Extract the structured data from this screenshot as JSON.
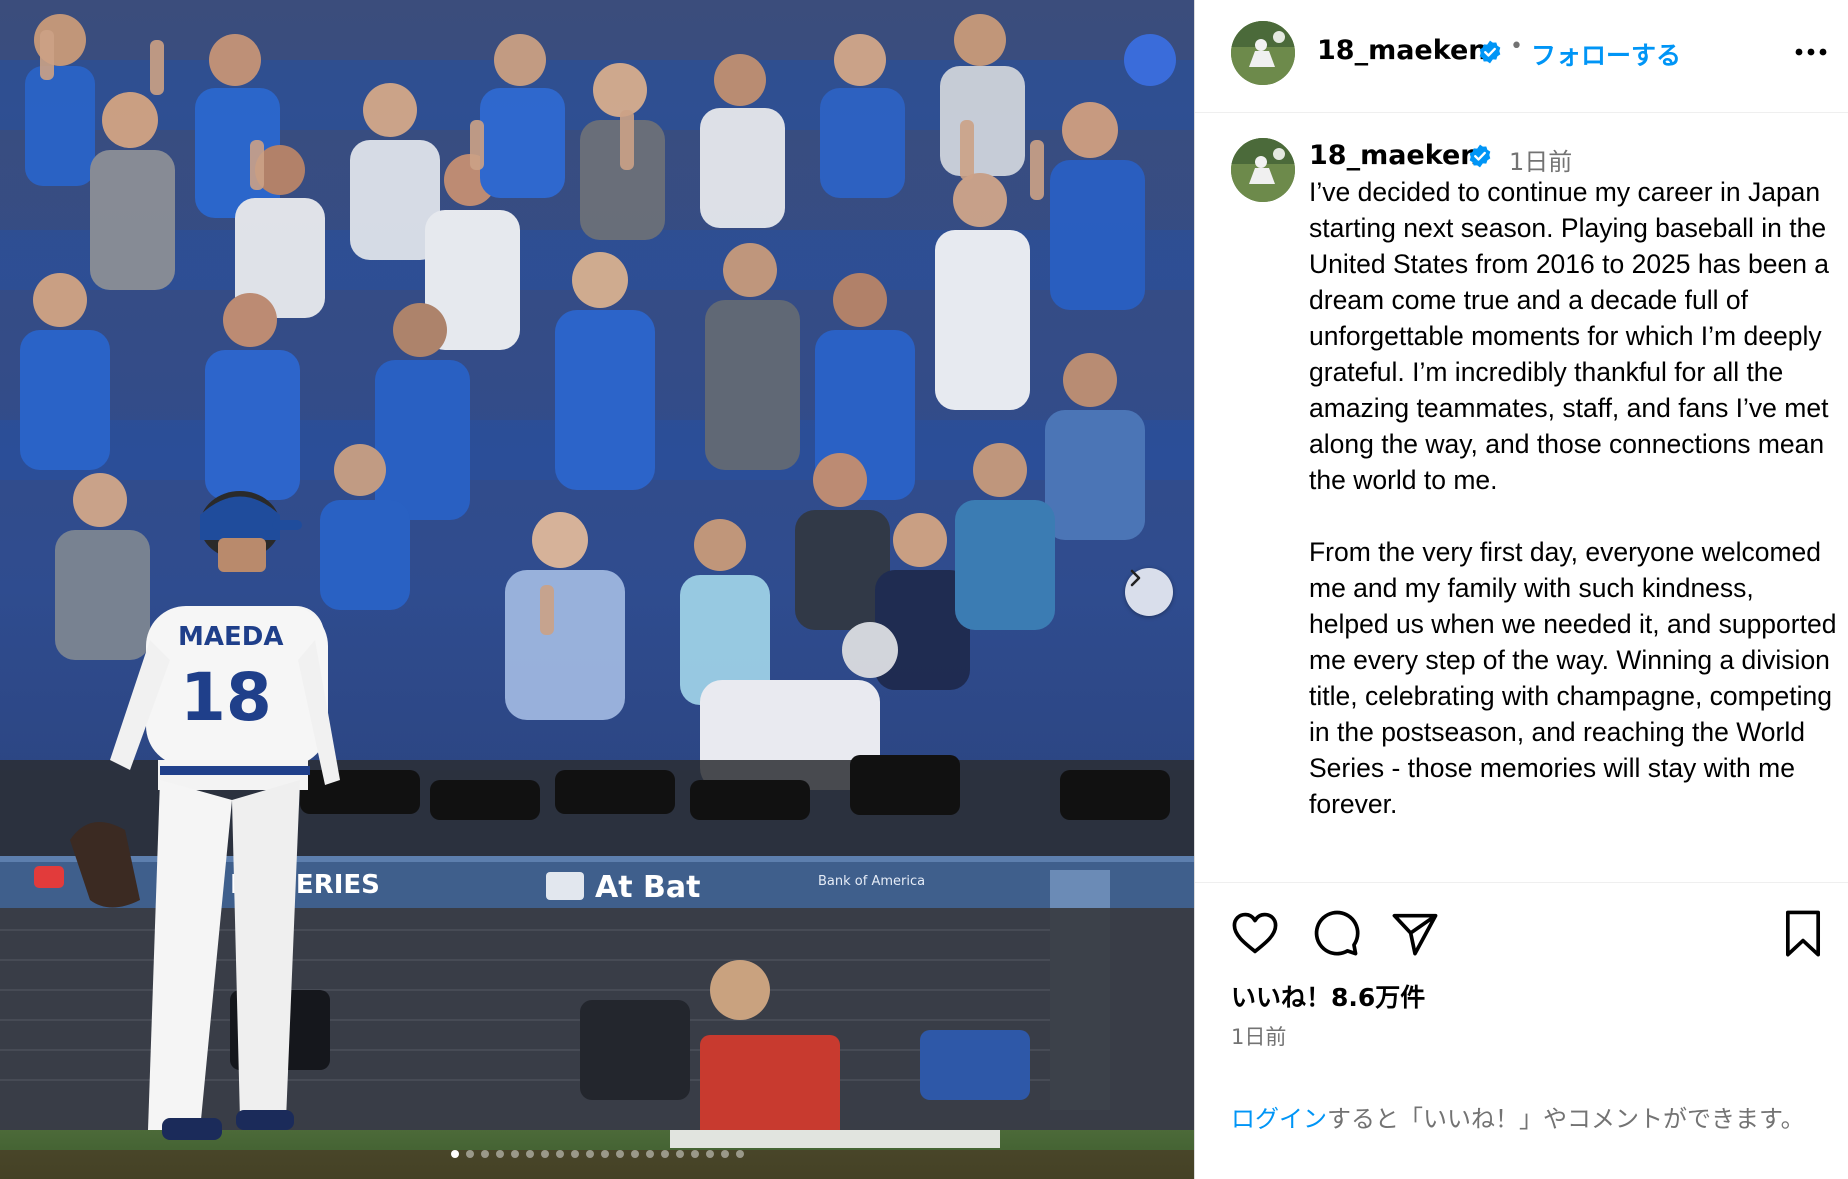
{
  "post": {
    "username": "18_maeken",
    "follow_label": "フォローする",
    "separator": "•",
    "caption_time": "1日前",
    "caption": "I’ve decided to continue my career in Japan starting next season. Playing baseball in the United States from 2016 to 2025 has been a dream come true and a decade full of unforgettable moments for which I’m deeply grateful. I’m incredibly thankful for all the amazing teammates, staff, and fans I’ve met along the way, and those connections mean the world to me.\n\nFrom the very first day, everyone welcomed me and my family with such kindness, helped us when we needed it, and supported me every step of the way. Winning a division title, celebrating with champagne, competing in the postseason, and reaching the World Series - those memories will stay with me forever.",
    "likes": "いいね！8.6万件",
    "post_time": "1日前",
    "login_link": "ログイン",
    "login_rest": "すると「いいね！」やコメントができます。"
  },
  "photo": {
    "jersey_name": "MAEDA",
    "jersey_number": "18",
    "banner_series": "LD SERIES",
    "banner_atbat": "At Bat",
    "banner_bank": "Bank of America"
  },
  "carousel": {
    "total": 20,
    "active_index": 0
  },
  "icons": {
    "verified": "verified-badge-icon",
    "more": "more-options-icon",
    "like": "heart-icon",
    "comment": "comment-icon",
    "share": "share-icon",
    "save": "bookmark-icon",
    "next": "chevron-right-icon"
  },
  "colors": {
    "link_blue": "#0095f6",
    "verified_blue": "#0095f6",
    "muted_text": "#737373",
    "dodger_blue": "#1f5bb5"
  }
}
